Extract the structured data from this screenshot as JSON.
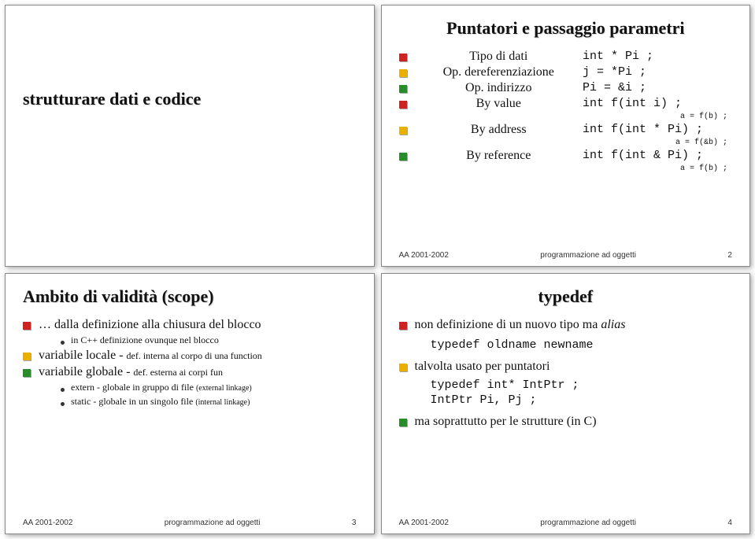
{
  "footer": {
    "left": "AA 2001-2002",
    "center": "programmazione ad oggetti"
  },
  "slide1": {
    "title": "strutturare dati e codice"
  },
  "slide2": {
    "title": "Puntatori e passaggio parametri",
    "items": [
      {
        "label": "Tipo di dati",
        "code": "int * Pi ;"
      },
      {
        "label": "Op. dereferenziazione",
        "code": "j = *Pi ;"
      },
      {
        "label": "Op. indirizzo",
        "code": "Pi = &i ;"
      },
      {
        "label": "By value",
        "code": "int f(int i) ;",
        "after": "a = f(b) ;"
      },
      {
        "label": "By address",
        "code": "int f(int * Pi) ;",
        "after": "a = f(&b) ;"
      },
      {
        "label": "By reference",
        "code": "int f(int & Pi) ;",
        "after": "a = f(b) ;"
      }
    ],
    "page": "2"
  },
  "slide3": {
    "title": "Ambito di validità (scope)",
    "l1": "… dalla definizione alla chiusura del blocco",
    "l1a": "in C++ definizione ovunque nel blocco",
    "l2_pre": "variabile locale - ",
    "l2_post": "def. interna al corpo di una function",
    "l3_pre": "variabile globale - ",
    "l3_post": "def. esterna ai corpi fun",
    "l3a": "extern - globale in gruppo di file (external linkage)",
    "l3b": "static - globale in un singolo file (internal linkage)",
    "page": "3"
  },
  "slide4": {
    "title": "typedef",
    "l1_pre": "non definizione di un nuovo tipo ma ",
    "l1_em": "alias",
    "code1": "typedef oldname newname",
    "l2": "talvolta usato per puntatori",
    "code2a": "typedef int* IntPtr ;",
    "code2b": "IntPtr Pi, Pj ;",
    "l3": "ma soprattutto per le strutture (in C)",
    "page": "4"
  }
}
